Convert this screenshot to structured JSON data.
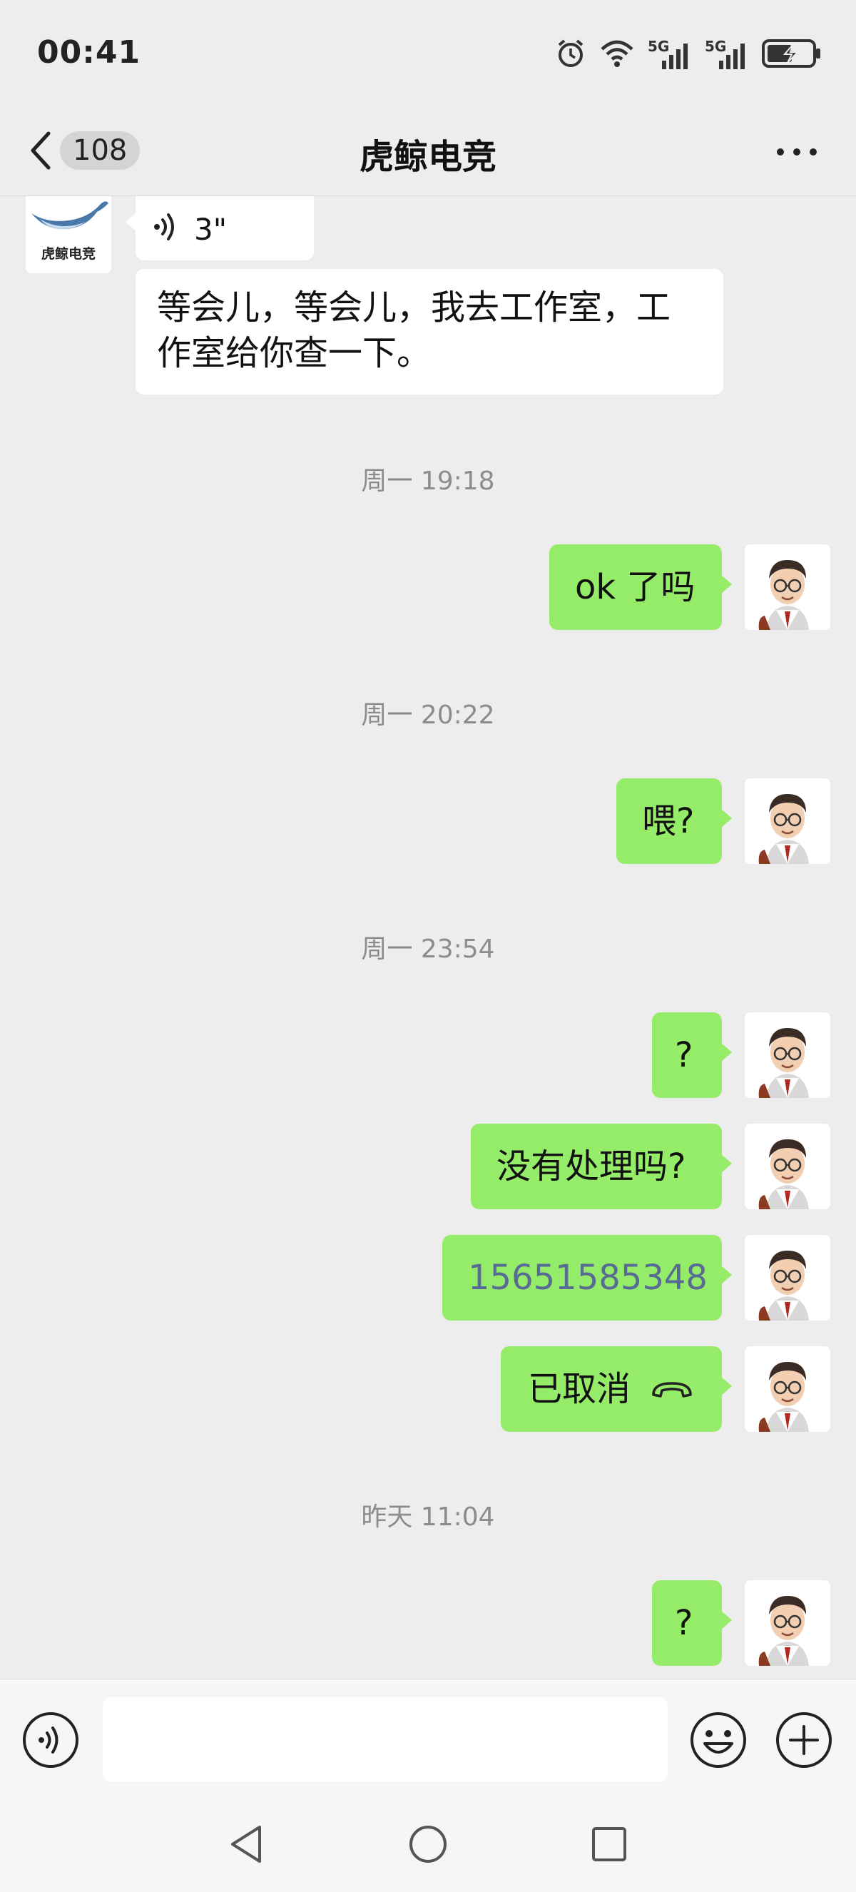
{
  "status_bar": {
    "time": "00:41",
    "network_1": "5G",
    "network_2": "5G"
  },
  "nav": {
    "back_count": "108",
    "title": "虎鲸电竞"
  },
  "contact_avatar": {
    "logo_text": "虎鲸电竞"
  },
  "messages": {
    "voice_duration": "3\"",
    "text_in_line1": "等会儿，等会儿，我去工作室，工",
    "text_in_line2": "作室给你查一下。",
    "time_1": "周一 19:18",
    "msg_ok": "ok 了吗",
    "time_2": "周一 20:22",
    "msg_wei": "喂?",
    "time_3": "周一 23:54",
    "msg_q1": "?",
    "msg_not_handled": "没有处理吗?",
    "msg_phone": "15651585348",
    "msg_cancelled": "已取消",
    "time_4": "昨天 11:04",
    "msg_q2": "?"
  },
  "colors": {
    "outgoing": "#95ec69",
    "incoming": "#ffffff",
    "background": "#ededed",
    "link": "#576b95"
  }
}
